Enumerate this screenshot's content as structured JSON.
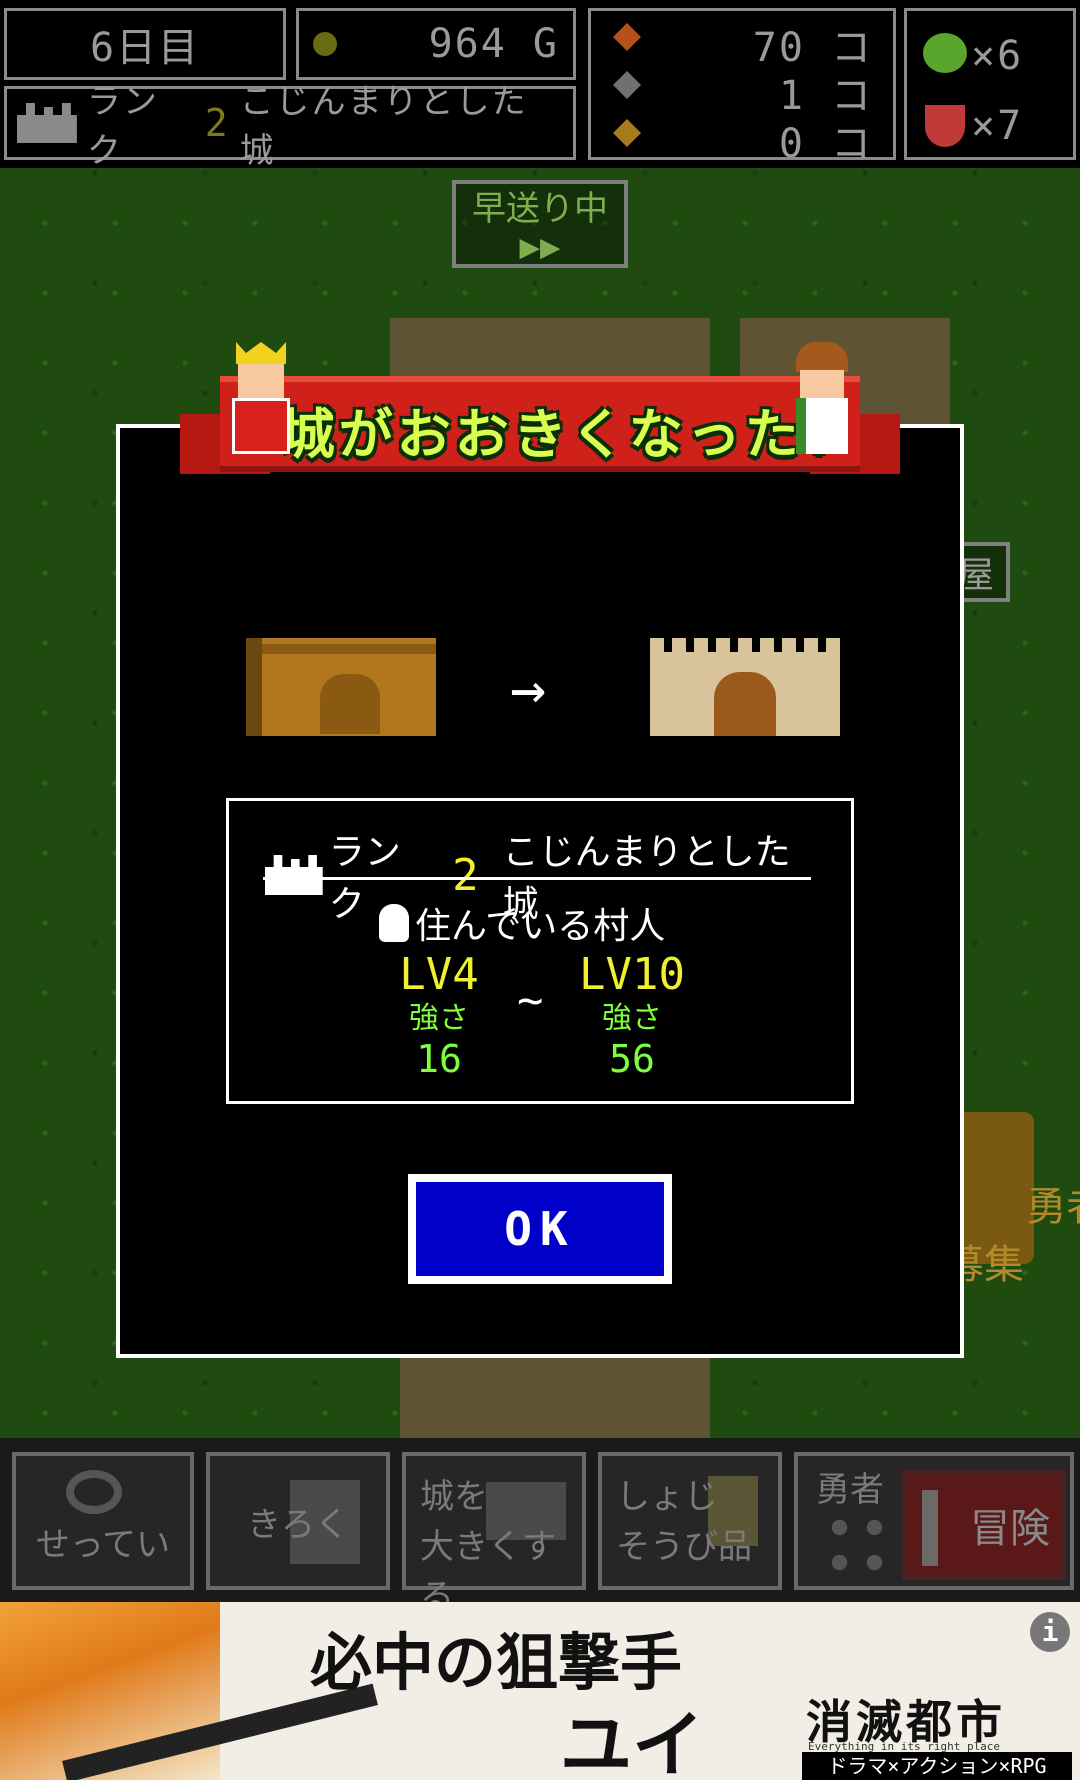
{
  "status": {
    "day": "6日目",
    "gold": "964 G",
    "rank_prefix": "ランク",
    "rank_num": "2",
    "castle_name": "こじんまりとした城",
    "resources": [
      {
        "icon": "orange-ore-icon",
        "count": "70 コ",
        "color": "#b5521c"
      },
      {
        "icon": "gray-ore-icon",
        "count": "1 コ",
        "color": "#707070"
      },
      {
        "icon": "gold-ore-icon",
        "count": "0 コ",
        "color": "#a77a1c"
      }
    ],
    "items": [
      {
        "icon": "apple-icon",
        "count": "×6"
      },
      {
        "icon": "potion-icon",
        "count": "×7"
      }
    ]
  },
  "fastforward": {
    "label": "早送り中",
    "arrows": "▶▶"
  },
  "bg_labels": {
    "shop": "屋",
    "recruit": "勇者\n募集"
  },
  "modal": {
    "title": "城がおおきくなった!",
    "arrow": "→",
    "rank_prefix": "ランク",
    "rank_num": "2",
    "castle_name": "こじんまりとした城",
    "villagers_label": "住んでいる村人",
    "min_level": "LV4",
    "max_level": "LV10",
    "tilde": "~",
    "strength_label": "強さ",
    "min_strength": "16",
    "max_strength": "56",
    "ok": "OK"
  },
  "bottom": {
    "settings": "せってい",
    "record": "きろく",
    "upgrade_line1": "城を",
    "upgrade_line2": "大きくする",
    "equip_line1": "しょじ",
    "equip_line2": "そうび品",
    "hero": "勇者",
    "adventure": "冒険"
  },
  "ad": {
    "headline1": "必中の狙撃手",
    "headline2": "ユイ",
    "logo": "消滅都市",
    "logo_sub": "Everything in its right place",
    "tagline": "ドラマ×アクション×RPG",
    "info": "i"
  },
  "colors": {
    "grass": "#1f4a10",
    "ribbon": "#d0201a",
    "ok_button": "#0000c8",
    "level_yellow": "#f0f030",
    "strength_green": "#7cff3c"
  }
}
